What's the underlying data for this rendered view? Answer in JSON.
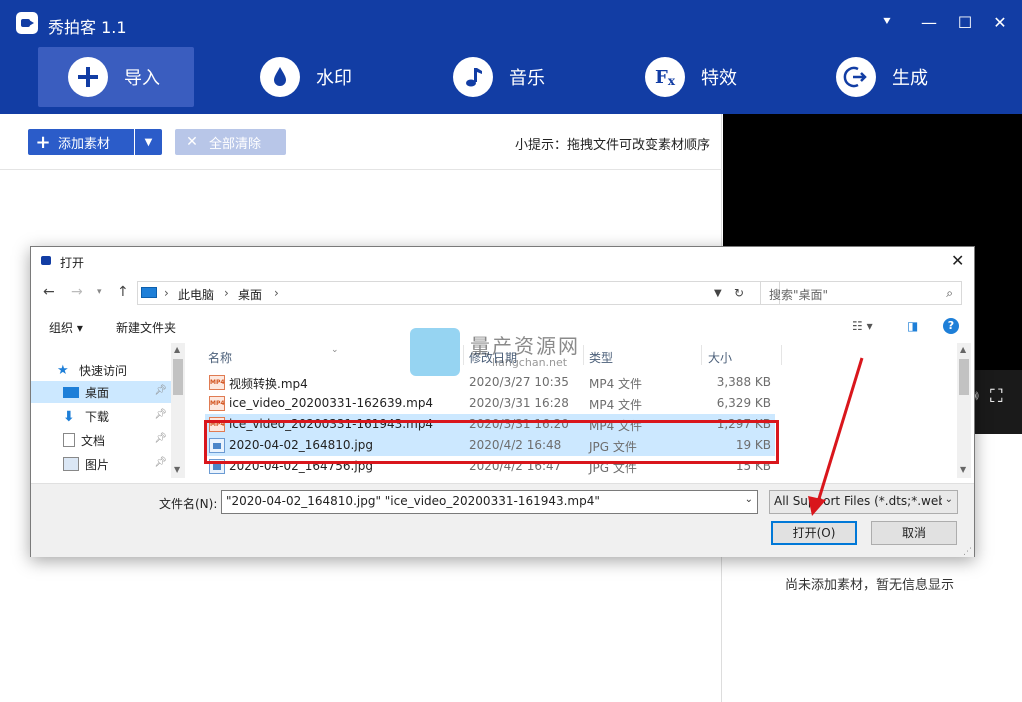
{
  "app": {
    "title": "秀拍客 1.1"
  },
  "window_controls": {
    "menu": "⯆",
    "minimize": "—",
    "maximize": "☐",
    "close": "✕"
  },
  "toolbar": {
    "items": [
      {
        "label": "导入",
        "icon": "plus-icon"
      },
      {
        "label": "水印",
        "icon": "water-drop-icon"
      },
      {
        "label": "音乐",
        "icon": "music-note-icon"
      },
      {
        "label": "特效",
        "icon": "fx-icon"
      },
      {
        "label": "生成",
        "icon": "export-icon"
      }
    ]
  },
  "sub_toolbar": {
    "add_label": "添加素材",
    "clear_label": "全部清除",
    "tip": "小提示：拖拽文件可改变素材顺序"
  },
  "preview": {
    "empty_text": "尚未添加素材，暂无信息显示"
  },
  "dialog": {
    "title": "打开",
    "breadcrumb": [
      "此电脑",
      "桌面"
    ],
    "search_placeholder": "搜索\"桌面\"",
    "organize": "组织",
    "new_folder": "新建文件夹",
    "nav_items": [
      {
        "label": "快速访问"
      },
      {
        "label": "桌面"
      },
      {
        "label": "下载"
      },
      {
        "label": "文档"
      },
      {
        "label": "图片"
      }
    ],
    "columns": {
      "name": "名称",
      "date": "修改日期",
      "type": "类型",
      "size": "大小"
    },
    "files": [
      {
        "name": "视频转换.mp4",
        "date": "2020/3/27 10:35",
        "type": "MP4 文件",
        "size": "3,388 KB",
        "kind": "mp4"
      },
      {
        "name": "ice_video_20200331-162639.mp4",
        "date": "2020/3/31 16:28",
        "type": "MP4 文件",
        "size": "6,329 KB",
        "kind": "mp4"
      },
      {
        "name": "ice_video_20200331-161943.mp4",
        "date": "2020/3/31 16:20",
        "type": "MP4 文件",
        "size": "1,297 KB",
        "kind": "mp4"
      },
      {
        "name": "2020-04-02_164810.jpg",
        "date": "2020/4/2 16:48",
        "type": "JPG 文件",
        "size": "19 KB",
        "kind": "jpg"
      },
      {
        "name": "2020-04-02_164756.jpg",
        "date": "2020/4/2 16:47",
        "type": "JPG 文件",
        "size": "15 KB",
        "kind": "jpg"
      }
    ],
    "filename_label": "文件名(N):",
    "filename_value": "\"2020-04-02_164810.jpg\" \"ice_video_20200331-161943.mp4\"",
    "filetype_value": "All Support Files (*.dts;*.web",
    "open_label": "打开(O)",
    "cancel_label": "取消"
  },
  "watermark": {
    "text": "量产资源网",
    "sub": "liangchan.net"
  },
  "colors": {
    "brand": "#123da4",
    "selection": "#cce8ff",
    "highlight": "#d9161c"
  }
}
